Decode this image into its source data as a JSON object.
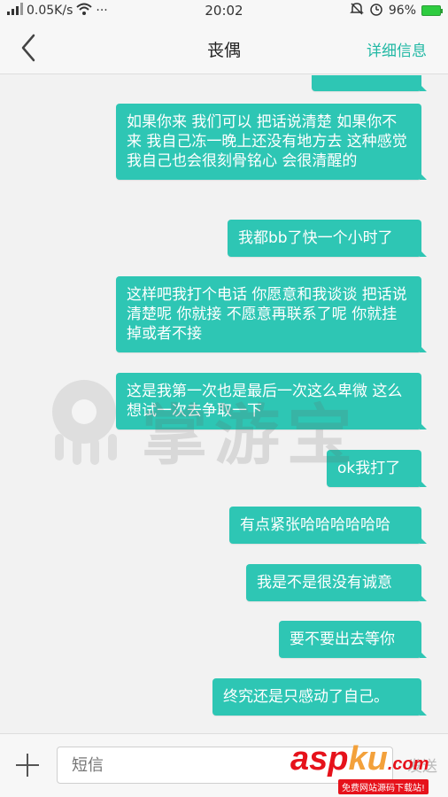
{
  "status_bar": {
    "network_speed": "0.05K/s",
    "more": "···",
    "time": "20:02",
    "battery_percent": "96%"
  },
  "nav": {
    "title": "丧偶",
    "detail_label": "详细信息"
  },
  "messages": [
    {
      "text": "",
      "from": "me"
    },
    {
      "text": "如果你来 我们可以 把话说清楚 如果你不来 我自己冻一晚上还没有地方去 这种感觉我自己也会很刻骨铭心 会很清醒的",
      "from": "me"
    },
    {
      "text": "我都bb了快一个小时了",
      "from": "me"
    },
    {
      "text": "这样吧我打个电话 你愿意和我谈谈 把话说清楚呢 你就接 不愿意再联系了呢 你就挂掉或者不接",
      "from": "me"
    },
    {
      "text": "这是我第一次也是最后一次这么卑微 这么想试一次去争取一下",
      "from": "me"
    },
    {
      "text": "ok我打了",
      "from": "me"
    },
    {
      "text": "有点紧张哈哈哈哈哈哈",
      "from": "me"
    },
    {
      "text": "我是不是很没有诚意",
      "from": "me"
    },
    {
      "text": "要不要出去等你",
      "from": "me"
    },
    {
      "text": "终究还是只感动了自己。",
      "from": "me"
    }
  ],
  "input": {
    "placeholder": "短信",
    "send_label": "发送"
  },
  "watermark": {
    "text": "掌游宝"
  },
  "site_logo": {
    "asp": "asp",
    "ku": "ku",
    "com": ".com",
    "tagline": "免费网站源码下载站!"
  },
  "colors": {
    "bubble": "#2ec6b4",
    "accent": "#21b8a4"
  }
}
